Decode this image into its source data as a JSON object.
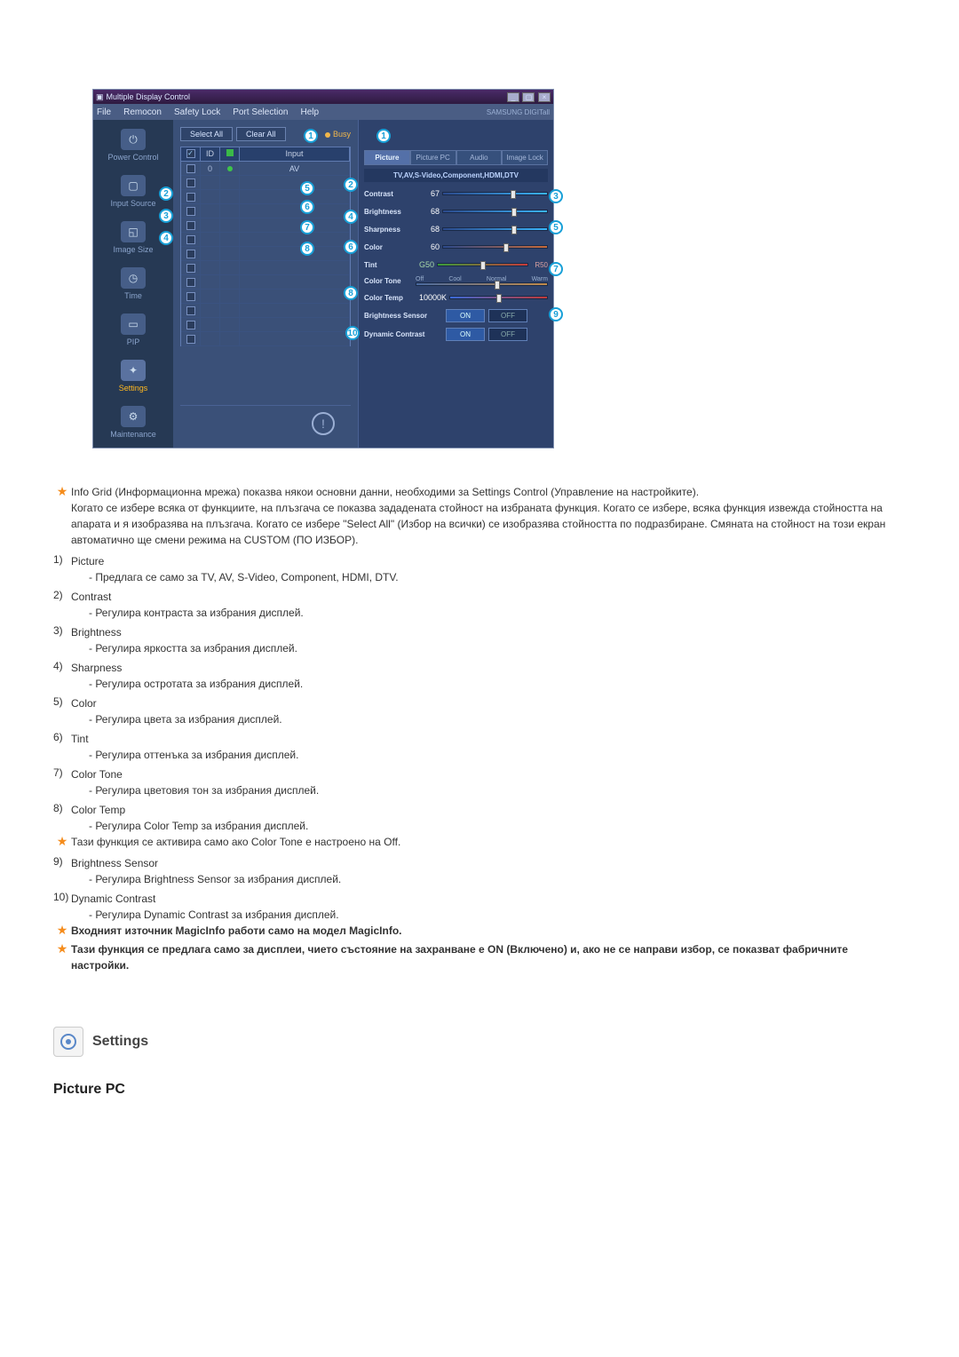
{
  "app": {
    "title": "Multiple Display Control",
    "menu": [
      "File",
      "Remocon",
      "Safety Lock",
      "Port Selection",
      "Help"
    ],
    "brand": "SAMSUNG DIGITall"
  },
  "sidebar": [
    {
      "label": "Power Control",
      "glyph": "⏻"
    },
    {
      "label": "Input Source",
      "glyph": "▢"
    },
    {
      "label": "Image Size",
      "glyph": "◱"
    },
    {
      "label": "Time",
      "glyph": "◷"
    },
    {
      "label": "PIP",
      "glyph": "▭"
    },
    {
      "label": "Settings",
      "glyph": "✦"
    },
    {
      "label": "Maintenance",
      "glyph": "⚙"
    }
  ],
  "toolbar": {
    "select_all": "Select All",
    "clear_all": "Clear All",
    "busy": "Busy"
  },
  "grid": {
    "headers": {
      "chk": "",
      "id": "ID",
      "blank": "",
      "input": "Input"
    },
    "first_row": {
      "id": "0",
      "input": "AV"
    }
  },
  "panel": {
    "tabs": [
      "Picture",
      "Picture PC",
      "Audio",
      "Image Lock"
    ],
    "subinfo": "TV,AV,S-Video,Component,HDMI,DTV",
    "sliders": {
      "contrast": {
        "label": "Contrast",
        "value": "67"
      },
      "brightness": {
        "label": "Brightness",
        "value": "68"
      },
      "sharpness": {
        "label": "Sharpness",
        "value": "68"
      },
      "color": {
        "label": "Color",
        "value": "60"
      },
      "tint": {
        "label": "Tint",
        "left": "G50",
        "right": "R50"
      },
      "colortone": {
        "label": "Color Tone",
        "opts": [
          "Off",
          "Cool",
          "Normal",
          "Warm"
        ]
      },
      "colortemp": {
        "label": "Color Temp",
        "value": "10000K"
      }
    },
    "toggles": {
      "brightness_sensor": {
        "label": "Brightness Sensor",
        "on": "ON",
        "off": "OFF"
      },
      "dynamic_contrast": {
        "label": "Dynamic Contrast",
        "on": "ON",
        "off": "OFF"
      }
    }
  },
  "callouts": {
    "c1": "1",
    "c1b": "1",
    "c2a": "2",
    "c2b": "2",
    "c3a": "3",
    "c3b": "3",
    "c4a": "4",
    "c4b": "4",
    "c5a": "5",
    "c5b": "5",
    "c6a": "6",
    "c6b": "6",
    "c7a": "7",
    "c7b": "7",
    "c8a": "8",
    "c8b": "8",
    "c9": "9",
    "c10": "10"
  },
  "notes": {
    "star1": "Info Grid (Информационна мрежа) показва някои основни данни, необходими за Settings Control (Управление на настройките).",
    "star1b": "Когато се избере всяка от функциите, на плъзгача се показва зададената стойност на избраната функция. Когато се избере, всяка функция извежда стойността на апарата и я изобразява на плъзгача. Когато се избере \"Select All\" (Избор на всички) се изобразява стойността по подразбиране. Смяната на стойност на този екран автоматично ще смени режима на CUSTOM (ПО ИЗБОР).",
    "items": [
      {
        "n": "1)",
        "t": "Picture",
        "s": "- Предлага се само за TV, AV, S-Video, Component, HDMI, DTV."
      },
      {
        "n": "2)",
        "t": "Contrast",
        "s": "- Регулира контраста за избрания дисплей."
      },
      {
        "n": "3)",
        "t": "Brightness",
        "s": "- Регулира яркостта за избрания дисплей."
      },
      {
        "n": "4)",
        "t": "Sharpness",
        "s": "- Регулира остротата за избрания дисплей."
      },
      {
        "n": "5)",
        "t": "Color",
        "s": "- Регулира цвета за избрания дисплей."
      },
      {
        "n": "6)",
        "t": "Tint",
        "s": "- Регулира оттенъка за избрания дисплей."
      },
      {
        "n": "7)",
        "t": "Color Tone",
        "s": "- Регулира цветовия тон за избрания дисплей."
      },
      {
        "n": "8)",
        "t": "Color Temp",
        "s": "- Регулира Color Temp за избрания дисплей."
      }
    ],
    "star_mid": "Тази функция се активира само ако Color Tone е настроено на Off.",
    "items2": [
      {
        "n": "9)",
        "t": "Brightness Sensor",
        "s": "- Регулира Brightness Sensor за избрания дисплей."
      },
      {
        "n": "10)",
        "t": "Dynamic Contrast",
        "s": "- Регулира Dynamic Contrast за избрания дисплей."
      }
    ],
    "star2": "Входният източник MagicInfo работи само на модел MagicInfo.",
    "star3": "Тази функция се предлага само за дисплеи, чието състояние на захранване е ON (Включено) и, ако не се направи избор, се показват фабричните настройки."
  },
  "section": {
    "title": "Settings"
  },
  "subheading": "Picture PC"
}
